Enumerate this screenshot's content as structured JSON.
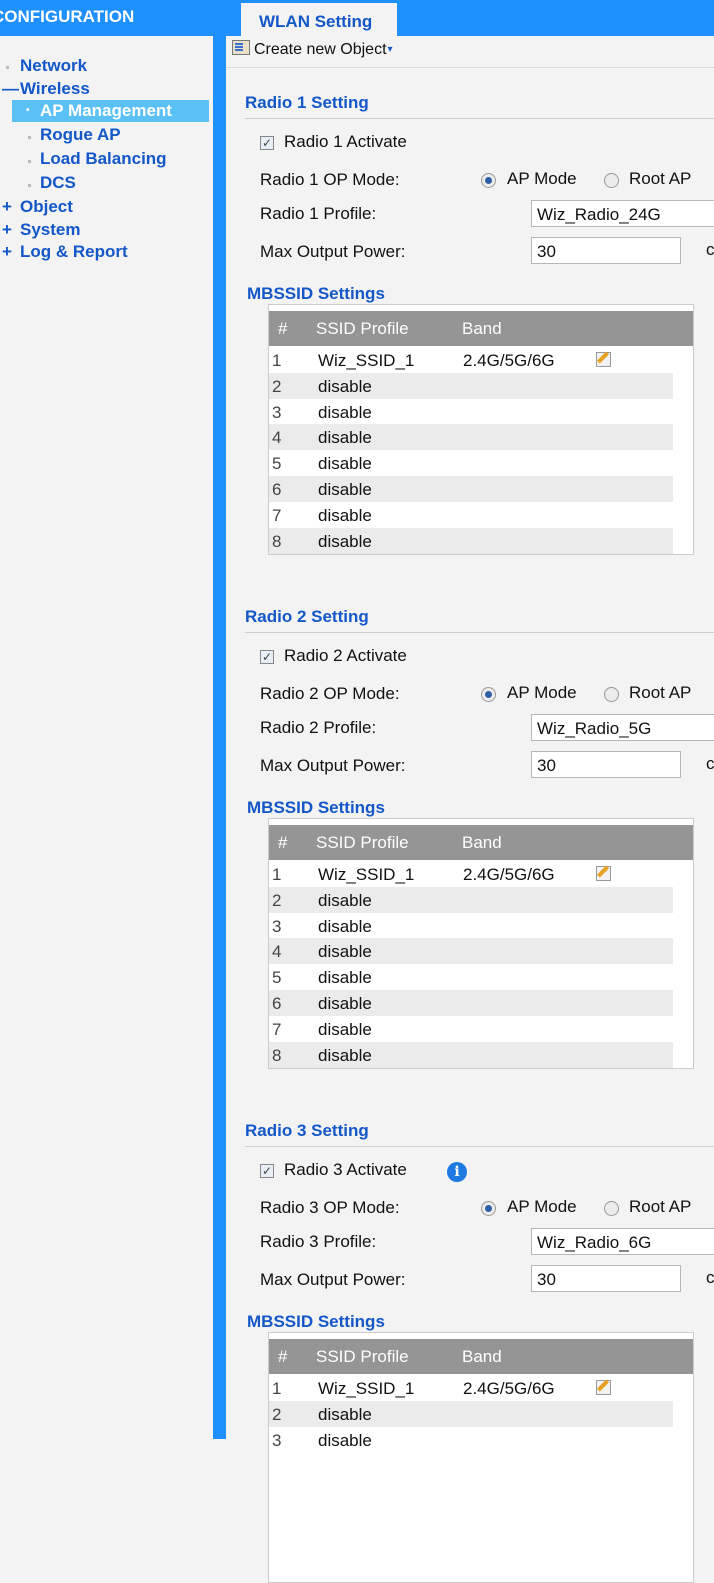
{
  "sidebar": {
    "header": "CONFIGURATION",
    "items": [
      {
        "label": "Network",
        "marker": ""
      },
      {
        "label": "Wireless",
        "marker": "—"
      },
      {
        "label": "AP Management",
        "marker": ""
      },
      {
        "label": "Rogue AP",
        "marker": ""
      },
      {
        "label": "Load Balancing",
        "marker": ""
      },
      {
        "label": "DCS",
        "marker": ""
      },
      {
        "label": "Object",
        "marker": "+"
      },
      {
        "label": "System",
        "marker": "+"
      },
      {
        "label": "Log & Report",
        "marker": "+"
      }
    ]
  },
  "tab": {
    "label": "WLAN Setting"
  },
  "toolbar": {
    "create_label": "Create new Object",
    "caret": "▾"
  },
  "mbssid_title": "MBSSID Settings",
  "table_headers": {
    "num": "#",
    "profile": "SSID Profile",
    "band": "Band"
  },
  "radios": [
    {
      "title": "Radio 1 Setting",
      "activate_label": "Radio 1 Activate",
      "activated": true,
      "op_mode_label": "Radio 1 OP Mode:",
      "mode_ap": "AP Mode",
      "mode_root": "Root AP",
      "profile_label": "Radio 1 Profile:",
      "profile_value": "Wiz_Radio_24G",
      "power_label": "Max Output Power:",
      "power_value": "30",
      "power_unit": "c",
      "rows": [
        {
          "num": "1",
          "profile": "Wiz_SSID_1",
          "band": "2.4G/5G/6G"
        },
        {
          "num": "2",
          "profile": "disable",
          "band": ""
        },
        {
          "num": "3",
          "profile": "disable",
          "band": ""
        },
        {
          "num": "4",
          "profile": "disable",
          "band": ""
        },
        {
          "num": "5",
          "profile": "disable",
          "band": ""
        },
        {
          "num": "6",
          "profile": "disable",
          "band": ""
        },
        {
          "num": "7",
          "profile": "disable",
          "band": ""
        },
        {
          "num": "8",
          "profile": "disable",
          "band": ""
        }
      ]
    },
    {
      "title": "Radio 2 Setting",
      "activate_label": "Radio 2 Activate",
      "activated": true,
      "op_mode_label": "Radio 2 OP Mode:",
      "mode_ap": "AP Mode",
      "mode_root": "Root AP",
      "profile_label": "Radio 2 Profile:",
      "profile_value": "Wiz_Radio_5G",
      "power_label": "Max Output Power:",
      "power_value": "30",
      "power_unit": "c",
      "rows": [
        {
          "num": "1",
          "profile": "Wiz_SSID_1",
          "band": "2.4G/5G/6G"
        },
        {
          "num": "2",
          "profile": "disable",
          "band": ""
        },
        {
          "num": "3",
          "profile": "disable",
          "band": ""
        },
        {
          "num": "4",
          "profile": "disable",
          "band": ""
        },
        {
          "num": "5",
          "profile": "disable",
          "band": ""
        },
        {
          "num": "6",
          "profile": "disable",
          "band": ""
        },
        {
          "num": "7",
          "profile": "disable",
          "band": ""
        },
        {
          "num": "8",
          "profile": "disable",
          "band": ""
        }
      ]
    },
    {
      "title": "Radio 3 Setting",
      "activate_label": "Radio 3 Activate",
      "activated": true,
      "op_mode_label": "Radio 3 OP Mode:",
      "mode_ap": "AP Mode",
      "mode_root": "Root AP",
      "profile_label": "Radio 3 Profile:",
      "profile_value": "Wiz_Radio_6G",
      "power_label": "Max Output Power:",
      "power_value": "30",
      "power_unit": "c",
      "rows": [
        {
          "num": "1",
          "profile": "Wiz_SSID_1",
          "band": "2.4G/5G/6G"
        },
        {
          "num": "2",
          "profile": "disable",
          "band": ""
        },
        {
          "num": "3",
          "profile": "disable",
          "band": ""
        }
      ]
    }
  ],
  "colors": {
    "accent": "#1e90ff",
    "link": "#1357c8",
    "selected": "#5bc0f3",
    "table_header": "#959595"
  }
}
